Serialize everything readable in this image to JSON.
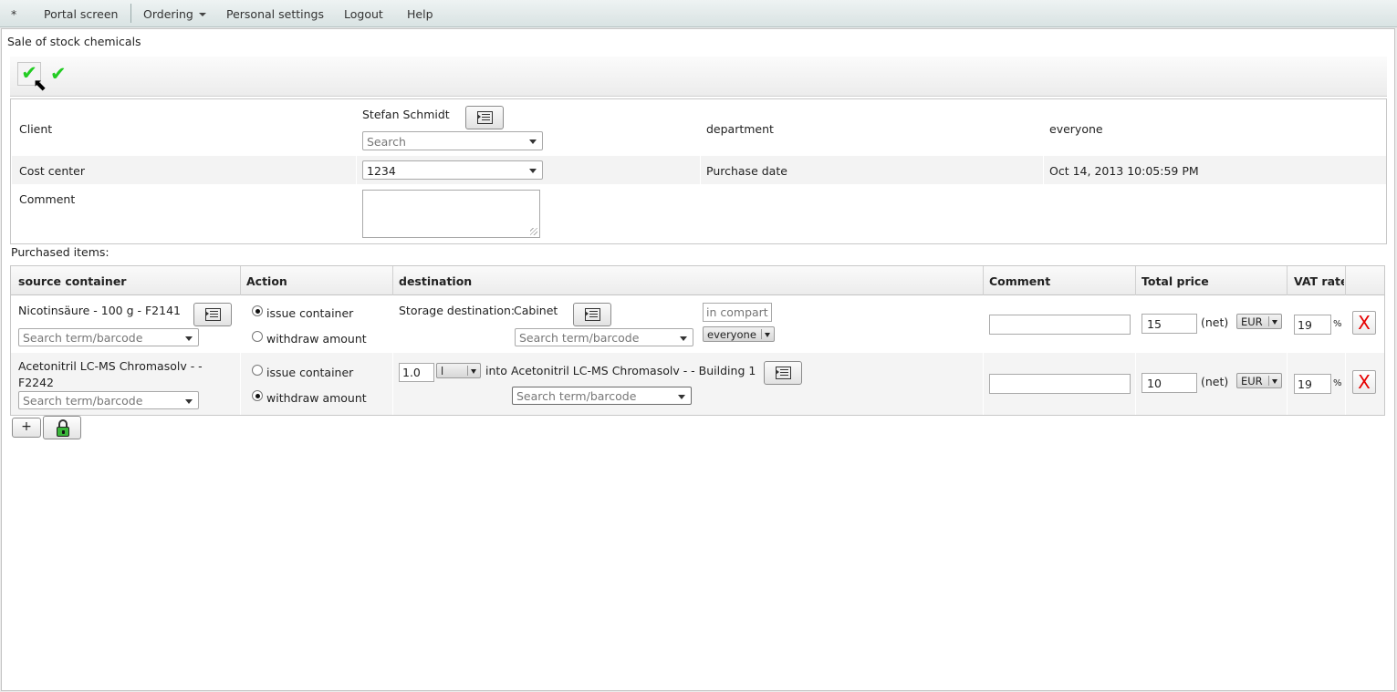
{
  "menu": {
    "star": "*",
    "portal": "Portal screen",
    "ordering": "Ordering",
    "personal_settings": "Personal settings",
    "logout": "Logout",
    "help": "Help"
  },
  "panel": {
    "title": "Sale of stock chemicals"
  },
  "toolbar": {
    "icons": [
      "check-icon",
      "check-icon"
    ]
  },
  "form": {
    "client_label": "Client",
    "client_value": "Stefan Schmidt",
    "client_search_placeholder": "Search",
    "department_label": "department",
    "department_value": "everyone",
    "cost_center_label": "Cost center",
    "cost_center_value": "1234",
    "purchase_date_label": "Purchase date",
    "purchase_date_value": "Oct 14, 2013 10:05:59 PM",
    "comment_label": "Comment",
    "comment_value": ""
  },
  "items_label": "Purchased items:",
  "table": {
    "headers": {
      "source": "source container",
      "action": "Action",
      "destination": "destination",
      "comment": "Comment",
      "total_price": "Total price",
      "vat_rate": "VAT rate"
    },
    "rows": [
      {
        "source_name": "Nicotinsäure - 100 g - F2141",
        "source_search_placeholder": "Search term/barcode",
        "action_issue": "issue container",
        "action_withdraw": "withdraw amount",
        "selected_action": "issue",
        "storage_label": "Storage destination:",
        "storage_value": "Cabinet",
        "dest_search_placeholder": "Search term/barcode",
        "compartment_placeholder": "in compartr",
        "owner_value": "everyone",
        "comment": "",
        "price": "15",
        "net_label": "(net)",
        "currency": "EUR",
        "vat": "19",
        "percent": "%",
        "delete": "X"
      },
      {
        "source_name_line1": "Acetonitril LC-MS Chromasolv - -",
        "source_name_line2": "F2242",
        "source_search_placeholder": "Search term/barcode",
        "action_issue": "issue container",
        "action_withdraw": "withdraw amount",
        "selected_action": "withdraw",
        "amount": "1.0",
        "unit": "l",
        "into_label": "into",
        "into_value": "Acetonitril LC-MS Chromasolv - - Building 1",
        "dest_search_placeholder": "Search term/barcode",
        "comment": "",
        "price": "10",
        "net_label": "(net)",
        "currency": "EUR",
        "vat": "19",
        "percent": "%",
        "delete": "X"
      }
    ]
  },
  "add_button": "+",
  "colors": {
    "check": "#22cc22",
    "delete": "#e60000",
    "lock": "#3ab63a"
  }
}
